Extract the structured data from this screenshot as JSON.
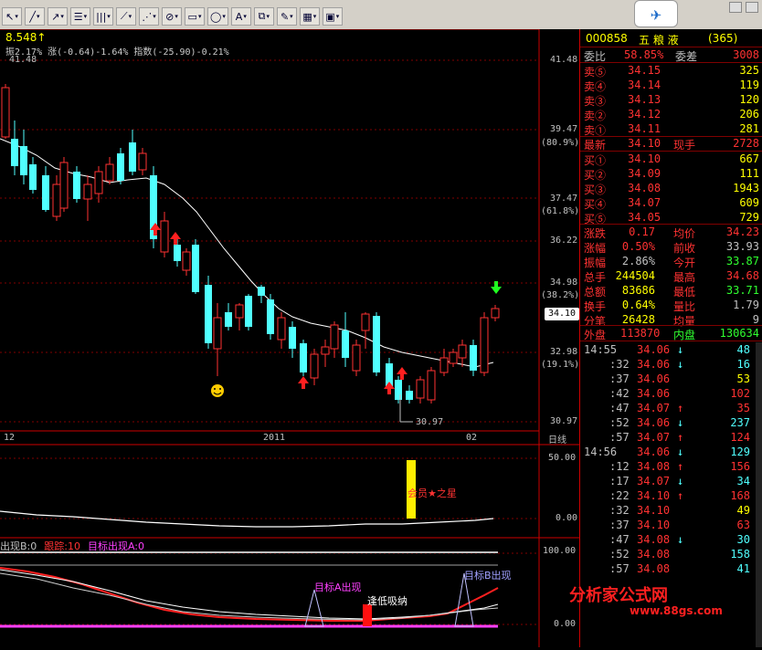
{
  "toolbar": {
    "tools": [
      {
        "label": "↖",
        "icon": "cursor-icon"
      },
      {
        "label": "╱",
        "icon": "line-icon"
      },
      {
        "label": "↗",
        "icon": "ray-icon"
      },
      {
        "label": "☰",
        "icon": "parallel-icon"
      },
      {
        "label": "|||",
        "icon": "vertical-lines-icon"
      },
      {
        "label": "⟋",
        "icon": "fan-icon"
      },
      {
        "label": "⋰",
        "icon": "speed-line-icon"
      },
      {
        "label": "⊘",
        "icon": "gann-icon"
      },
      {
        "label": "▭",
        "icon": "rectangle-icon"
      },
      {
        "label": "◯",
        "icon": "ellipse-icon"
      },
      {
        "label": "A",
        "icon": "text-icon"
      },
      {
        "label": "⧉",
        "icon": "copy-icon"
      },
      {
        "label": "✎",
        "icon": "eraser-icon"
      },
      {
        "label": "▦",
        "icon": "palette-icon"
      },
      {
        "label": "▣",
        "icon": "save-icon"
      }
    ]
  },
  "main": {
    "header": "8.548↑",
    "indicator": "振2.17% 涨(-0.64)-1.64% 指数(-25.90)-0.21%",
    "ma_label": "41.48",
    "y_labels": [
      {
        "v": "41.48"
      },
      {
        "v": "39.47"
      },
      {
        "v": "(80.9%)"
      },
      {
        "v": "37.47"
      },
      {
        "v": "(61.8%)"
      },
      {
        "v": "36.22"
      },
      {
        "v": "34.98"
      },
      {
        "v": "(38.2%)"
      },
      {
        "v": "32.98"
      },
      {
        "v": "(19.1%)"
      },
      {
        "v": "30.97"
      }
    ],
    "low_label": "30.97",
    "price_tag": "34.10",
    "x_labels": [
      "12",
      "2011",
      "02"
    ],
    "timeframe": "日线"
  },
  "sub1": {
    "y_labels": [
      "50.00",
      "0.00"
    ],
    "annotation": "会员★之星"
  },
  "sub2": {
    "legend": [
      {
        "t": "出现B:0",
        "c": "#c0c0c0"
      },
      {
        "t": "跟踪:10",
        "c": "#ff3232"
      },
      {
        "t": "目标出现A:0",
        "c": "#ff40ff"
      }
    ],
    "y_labels": [
      "100.00",
      "0.00"
    ],
    "labels": {
      "a": "目标A出现",
      "b": "目标B出现",
      "c": "逢低吸纳"
    }
  },
  "quote": {
    "code": "000858",
    "name": "五 粮 液",
    "num": "(365)",
    "ratio_label": "委比",
    "ratio": "58.85%",
    "diff_label": "委差",
    "diff": "3008",
    "asks": [
      {
        "l": "卖⑤",
        "p": "34.15",
        "v": "325"
      },
      {
        "l": "卖④",
        "p": "34.14",
        "v": "119"
      },
      {
        "l": "卖③",
        "p": "34.13",
        "v": "120"
      },
      {
        "l": "卖②",
        "p": "34.12",
        "v": "206"
      },
      {
        "l": "卖①",
        "p": "34.11",
        "v": "281"
      }
    ],
    "last_label": "最新",
    "last": "34.10",
    "hand_label": "现手",
    "hand": "2728",
    "bids": [
      {
        "l": "买①",
        "p": "34.10",
        "v": "667"
      },
      {
        "l": "买②",
        "p": "34.09",
        "v": "111"
      },
      {
        "l": "买③",
        "p": "34.08",
        "v": "1943"
      },
      {
        "l": "买④",
        "p": "34.07",
        "v": "609"
      },
      {
        "l": "买⑤",
        "p": "34.05",
        "v": "729"
      }
    ],
    "stats": [
      {
        "a": "涨跌",
        "av": "0.17",
        "b": "均价",
        "bv": "34.23",
        "ac": "#ff3232",
        "bc": "#ff3232"
      },
      {
        "a": "涨幅",
        "av": "0.50%",
        "b": "前收",
        "bv": "33.93",
        "ac": "#ff3232",
        "bc": "#c0c0c0"
      },
      {
        "a": "振幅",
        "av": "2.86%",
        "b": "今开",
        "bv": "33.87",
        "ac": "#c0c0c0",
        "bc": "#30ff30"
      },
      {
        "a": "总手",
        "av": "244504",
        "b": "最高",
        "bv": "34.68",
        "ac": "#ffff00",
        "bc": "#ff3232"
      },
      {
        "a": "总额",
        "av": "83686",
        "b": "最低",
        "bv": "33.71",
        "ac": "#ffff00",
        "bc": "#30ff30"
      },
      {
        "a": "换手",
        "av": "0.64%",
        "b": "量比",
        "bv": "1.79",
        "ac": "#ffff00",
        "bc": "#c0c0c0"
      },
      {
        "a": "分笔",
        "av": "26428",
        "b": "均量",
        "bv": "9",
        "ac": "#ffff00",
        "bc": "#c0c0c0"
      }
    ],
    "out_label": "外盘",
    "out": "113870",
    "in_label": "内盘",
    "in": "130634",
    "ticks": [
      {
        "t": "14:55",
        "p": "34.06",
        "v": "48",
        "d": "↓",
        "c": "#50ffff"
      },
      {
        "t": ":32",
        "p": "34.06",
        "v": "16",
        "d": "↓",
        "c": "#50ffff"
      },
      {
        "t": ":37",
        "p": "34.06",
        "v": "53",
        "d": "",
        "c": "#ffff00"
      },
      {
        "t": ":42",
        "p": "34.06",
        "v": "102",
        "d": "",
        "c": "#ff3232"
      },
      {
        "t": ":47",
        "p": "34.07",
        "v": "35",
        "d": "↑",
        "c": "#ff3232"
      },
      {
        "t": ":52",
        "p": "34.06",
        "v": "237",
        "d": "↓",
        "c": "#50ffff"
      },
      {
        "t": ":57",
        "p": "34.07",
        "v": "124",
        "d": "↑",
        "c": "#ff3232"
      },
      {
        "t": "14:56",
        "p": "34.06",
        "v": "129",
        "d": "↓",
        "c": "#50ffff"
      },
      {
        "t": ":12",
        "p": "34.08",
        "v": "156",
        "d": "↑",
        "c": "#ff3232"
      },
      {
        "t": ":17",
        "p": "34.07",
        "v": "34",
        "d": "↓",
        "c": "#50ffff"
      },
      {
        "t": ":22",
        "p": "34.10",
        "v": "168",
        "d": "↑",
        "c": "#ff3232"
      },
      {
        "t": ":32",
        "p": "34.10",
        "v": "49",
        "d": "",
        "c": "#ffff00"
      },
      {
        "t": ":37",
        "p": "34.10",
        "v": "63",
        "d": "",
        "c": "#ff3232"
      },
      {
        "t": ":47",
        "p": "34.08",
        "v": "30",
        "d": "↓",
        "c": "#50ffff"
      },
      {
        "t": ":52",
        "p": "34.08",
        "v": "158",
        "d": "",
        "c": "#50ffff"
      },
      {
        "t": ":57",
        "p": "34.08",
        "v": "41",
        "d": "",
        "c": "#50ffff"
      }
    ]
  },
  "watermark": {
    "brand": "分析家公式网",
    "url": "www.88gs.com"
  }
}
